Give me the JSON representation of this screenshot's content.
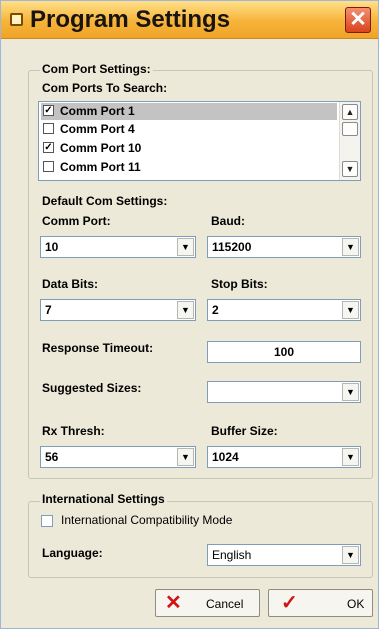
{
  "window": {
    "title": "Program Settings",
    "close_glyph": "✕"
  },
  "com_port_settings": {
    "legend": "Com Port Settings:",
    "ports_label": "Com Ports To Search:",
    "ports": [
      {
        "label": "Comm Port 1",
        "checked": true,
        "selected": true
      },
      {
        "label": "Comm Port 4",
        "checked": false,
        "selected": false
      },
      {
        "label": "Comm Port 10",
        "checked": true,
        "selected": false
      },
      {
        "label": "Comm Port 11",
        "checked": false,
        "selected": false
      }
    ],
    "defaults_label": "Default Com Settings:",
    "comm_port": {
      "label": "Comm Port:",
      "value": "10"
    },
    "baud": {
      "label": "Baud:",
      "value": "115200"
    },
    "data_bits": {
      "label": "Data Bits:",
      "value": "7"
    },
    "stop_bits": {
      "label": "Stop Bits:",
      "value": "2"
    },
    "response_timeout": {
      "label": "Response Timeout:",
      "value": "100"
    },
    "suggested_sizes": {
      "label": "Suggested Sizes:",
      "value": ""
    },
    "rx_thresh": {
      "label": "Rx Thresh:",
      "value": "56"
    },
    "buffer_size": {
      "label": "Buffer Size:",
      "value": "1024"
    }
  },
  "international": {
    "legend": "International Settings",
    "compat_label": "International Compatibility Mode",
    "compat_checked": false,
    "language_label": "Language:",
    "language_value": "English"
  },
  "buttons": {
    "cancel": "Cancel",
    "ok": "OK"
  },
  "icons": {
    "scroll_up": "▲",
    "scroll_down": "▼",
    "dropdown": "▼",
    "check": "✓",
    "cancel": "✕",
    "ok": "✓"
  },
  "colors": {
    "cancel_icon": "#d01515",
    "ok_icon": "#d01515",
    "title_bar": "#f6b43a"
  }
}
